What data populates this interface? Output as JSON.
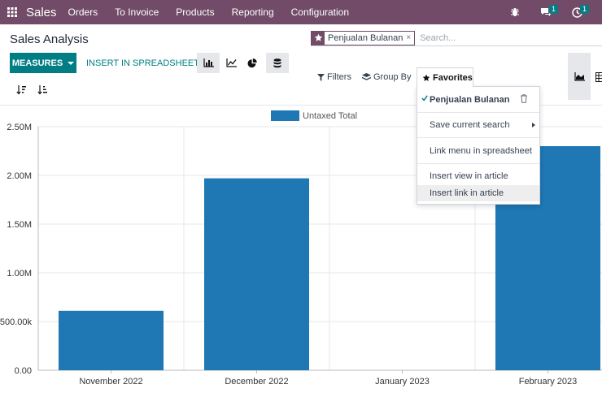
{
  "navbar": {
    "app_name": "Sales",
    "menu": [
      "Orders",
      "To Invoice",
      "Products",
      "Reporting",
      "Configuration"
    ],
    "chat_badge": "1",
    "activity_badge": "1"
  },
  "page": {
    "title": "Sales Analysis"
  },
  "search": {
    "facet_label": "Penjualan Bulanan",
    "placeholder": "Search..."
  },
  "toolbar": {
    "measures_label": "MEASURES",
    "spreadsheet_label": "INSERT IN SPREADSHEET",
    "filters_label": "Filters",
    "groupby_label": "Group By",
    "favorites_label": "Favorites"
  },
  "favorites_menu": {
    "saved_filter": "Penjualan Bulanan",
    "save_current": "Save current search",
    "link_spreadsheet": "Link menu in spreadsheet",
    "insert_view": "Insert view in article",
    "insert_link": "Insert link in article"
  },
  "colors": {
    "brand": "#714B67",
    "accent": "#017e84",
    "bar": "#1f77b4"
  },
  "icons": [
    "apps-icon",
    "bug-icon",
    "chat-icon",
    "clock-icon",
    "bar-chart-icon",
    "line-chart-icon",
    "pie-chart-icon",
    "database-icon",
    "sort-desc-icon",
    "sort-asc-icon",
    "filter-icon",
    "layers-icon",
    "star-icon",
    "check-icon",
    "trash-icon",
    "area-chart-icon"
  ],
  "chart_data": {
    "type": "bar",
    "title": "",
    "xlabel": "",
    "ylabel": "",
    "legend": "top-center",
    "grid": true,
    "ylim": [
      0,
      2500000
    ],
    "y_ticks": [
      "0.00",
      "500.00k",
      "1.00M",
      "1.50M",
      "2.00M",
      "2.50M"
    ],
    "categories": [
      "November 2022",
      "December 2022",
      "January 2023",
      "February 2023"
    ],
    "series": [
      {
        "name": "Untaxed Total",
        "values": [
          610000,
          1970000,
          0,
          2300000
        ]
      }
    ]
  }
}
